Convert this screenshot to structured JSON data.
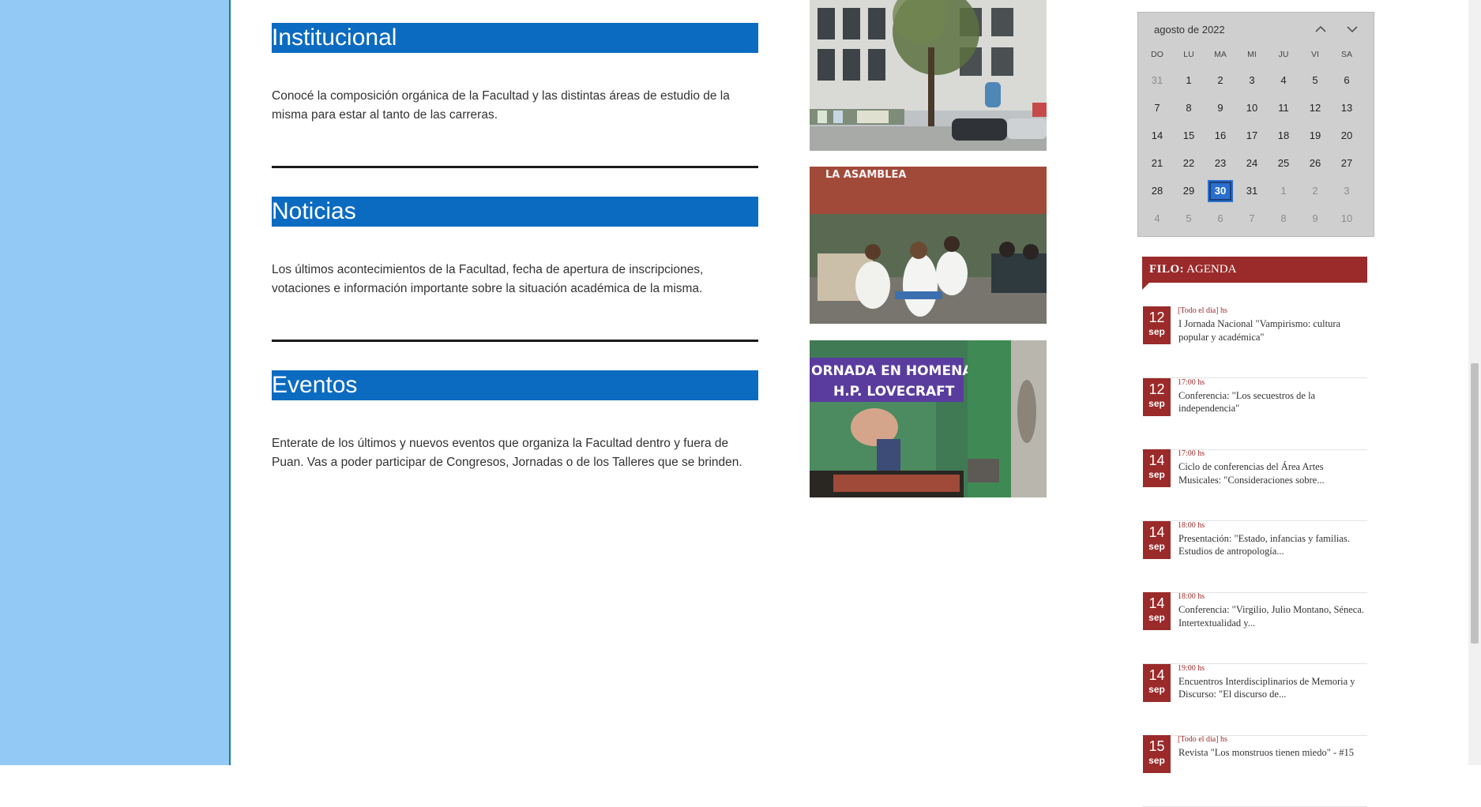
{
  "sections": [
    {
      "title": "Institucional",
      "text_line1": "Conocé la composición orgánica de la Facultad y las distintas áreas de estudio de la",
      "text_line2": "misma para estar al tanto de las carreras."
    },
    {
      "title": "Noticias",
      "text_line1": "Los últimos acontecimientos de la Facultad, fecha de apertura de inscripciones,",
      "text_line2": "votaciones e información importante sobre la situación académica de la misma."
    },
    {
      "title": "Eventos",
      "text_line1": "Enterate de los últimos y nuevos eventos que organiza la Facultad dentro y fuera de",
      "text_line2": "Puan. Vas a poder participar de Congresos, Jornadas o de los Talleres que se brinden."
    }
  ],
  "photos": {
    "banner_1": "ORNADA EN HOMENAJE",
    "banner_2": "H.P. LOVECRAFT",
    "sign_text": "LA ASAMBLEA"
  },
  "calendar": {
    "month_label": "agosto de 2022",
    "weekdays": [
      "DO",
      "LU",
      "MA",
      "MI",
      "JU",
      "VI",
      "SA"
    ],
    "weeks": [
      [
        "31",
        "1",
        "2",
        "3",
        "4",
        "5",
        "6"
      ],
      [
        "7",
        "8",
        "9",
        "10",
        "11",
        "12",
        "13"
      ],
      [
        "14",
        "15",
        "16",
        "17",
        "18",
        "19",
        "20"
      ],
      [
        "21",
        "22",
        "23",
        "24",
        "25",
        "26",
        "27"
      ],
      [
        "28",
        "29",
        "30",
        "31",
        "1",
        "2",
        "3"
      ],
      [
        "4",
        "5",
        "6",
        "7",
        "8",
        "9",
        "10"
      ]
    ],
    "selected_day": "30",
    "icons": {
      "prev": "chevron-up-icon",
      "next": "chevron-down-icon"
    }
  },
  "agenda": {
    "title_bold": "FILO:",
    "title_rest": " AGENDA",
    "events": [
      {
        "day": "12",
        "month": "sep",
        "time": "[Todo el día] hs",
        "title": "I Jornada Nacional \"Vampirismo: cultura popular y académica\""
      },
      {
        "day": "12",
        "month": "sep",
        "time": "17:00 hs",
        "title": "Conferencia: \"Los secuestros de la independencia\""
      },
      {
        "day": "14",
        "month": "sep",
        "time": "17:00 hs",
        "title": "Ciclo de conferencias del Área Artes Musicales: \"Consideraciones sobre..."
      },
      {
        "day": "14",
        "month": "sep",
        "time": "18:00 hs",
        "title": "Presentación: \"Estado, infancias y familias. Estudios de antropología..."
      },
      {
        "day": "14",
        "month": "sep",
        "time": "18:00 hs",
        "title": "Conferencia: \"Virgilio, Julio Montano, Séneca. Intertextualidad y..."
      },
      {
        "day": "14",
        "month": "sep",
        "time": "19:00 hs",
        "title": "Encuentros Interdisciplinarios de Memoria y Discurso: \"El discurso de..."
      },
      {
        "day": "15",
        "month": "sep",
        "time": "[Todo el día] hs",
        "title": "Revista \"Los monstruos tienen miedo\" - #15"
      }
    ]
  },
  "colors": {
    "heading_blue": "#0b6bc1",
    "sidebar_blue": "#93c9f5",
    "agenda_red": "#9b2a2a",
    "calendar_selected": "#2a6fcf"
  }
}
